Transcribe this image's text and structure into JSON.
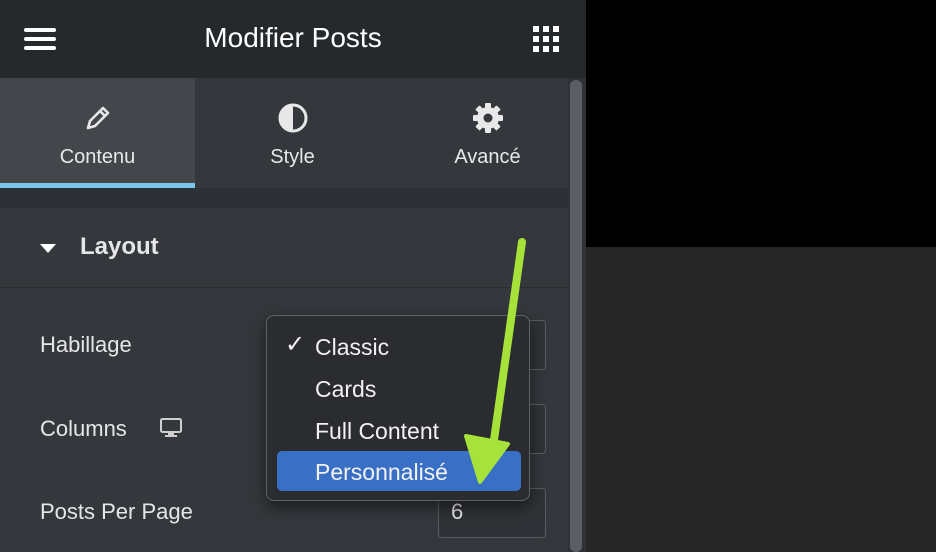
{
  "header": {
    "title": "Modifier Posts",
    "menu_icon": "hamburger-icon",
    "apps_icon": "grid-icon"
  },
  "tabs": [
    {
      "label": "Contenu",
      "icon": "pencil-icon",
      "active": true
    },
    {
      "label": "Style",
      "icon": "contrast-icon",
      "active": false
    },
    {
      "label": "Avancé",
      "icon": "gear-icon",
      "active": false
    }
  ],
  "section": {
    "title": "Layout"
  },
  "fields": {
    "habillage": {
      "label": "Habillage"
    },
    "columns": {
      "label": "Columns",
      "device_icon": "monitor-icon"
    },
    "posts_per_page": {
      "label": "Posts Per Page",
      "value": "6"
    }
  },
  "dropdown": {
    "options": [
      {
        "label": "Classic",
        "checked": true
      },
      {
        "label": "Cards"
      },
      {
        "label": "Full Content"
      },
      {
        "label": "Personnalisé",
        "highlighted": true
      }
    ],
    "checkmark": "✓"
  },
  "colors": {
    "accent_tab": "#79c6ea",
    "highlight": "#3a6fc6",
    "arrow": "#a6e23a"
  }
}
